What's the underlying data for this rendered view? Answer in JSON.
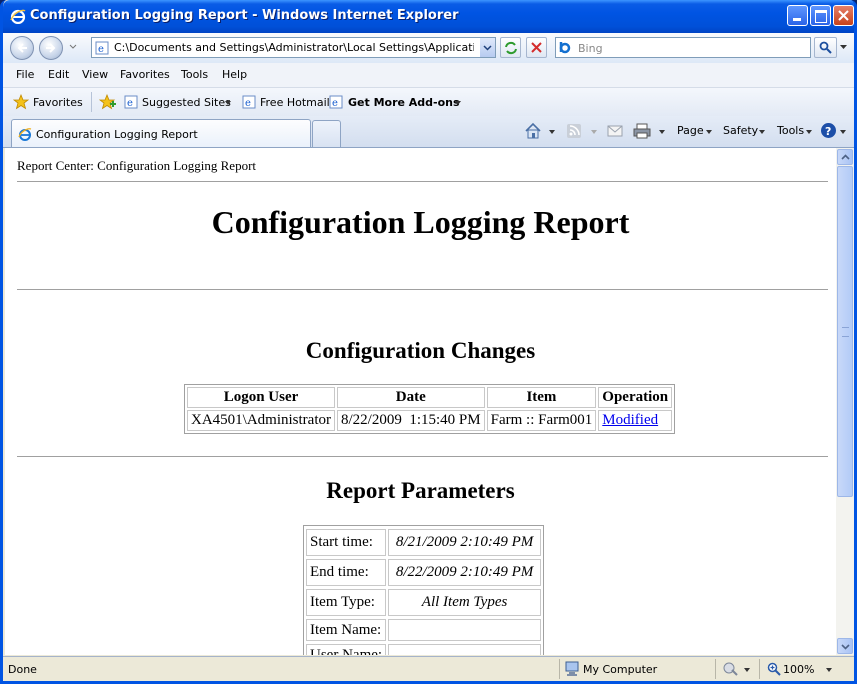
{
  "window": {
    "title": "Configuration Logging Report - Windows Internet Explorer"
  },
  "address": {
    "url": "C:\\Documents and Settings\\Administrator\\Local Settings\\Application Data\\C",
    "search_placeholder": "Bing"
  },
  "menu": [
    "File",
    "Edit",
    "View",
    "Favorites",
    "Tools",
    "Help"
  ],
  "favorites": {
    "favorites_label": "Favorites",
    "suggested": "Suggested Sites",
    "hotmail": "Free Hotmail",
    "addons": "Get More Add-ons"
  },
  "tab": {
    "label": "Configuration Logging Report"
  },
  "commands": {
    "page": "Page",
    "safety": "Safety",
    "tools": "Tools"
  },
  "report": {
    "breadcrumb": "Report Center: Configuration Logging Report",
    "title": "Configuration Logging Report",
    "changes_heading": "Configuration Changes",
    "changes_headers": [
      "Logon User",
      "Date",
      "Item",
      "Operation"
    ],
    "changes_row": {
      "user": "XA4501\\Administrator",
      "date": "8/22/2009  1:15:40 PM",
      "item": "Farm :: Farm001",
      "operation": "Modified"
    },
    "params_heading": "Report Parameters",
    "params": [
      {
        "label": "Start time:",
        "value": "8/21/2009 2:10:49 PM"
      },
      {
        "label": "End time:",
        "value": "8/22/2009 2:10:49 PM"
      },
      {
        "label": "Item Type:",
        "value": "All Item Types"
      },
      {
        "label": "Item Name:",
        "value": ""
      },
      {
        "label": "User Name:",
        "value": ""
      }
    ]
  },
  "status": {
    "text": "Done",
    "zone": "My Computer",
    "zoom": "100%"
  }
}
